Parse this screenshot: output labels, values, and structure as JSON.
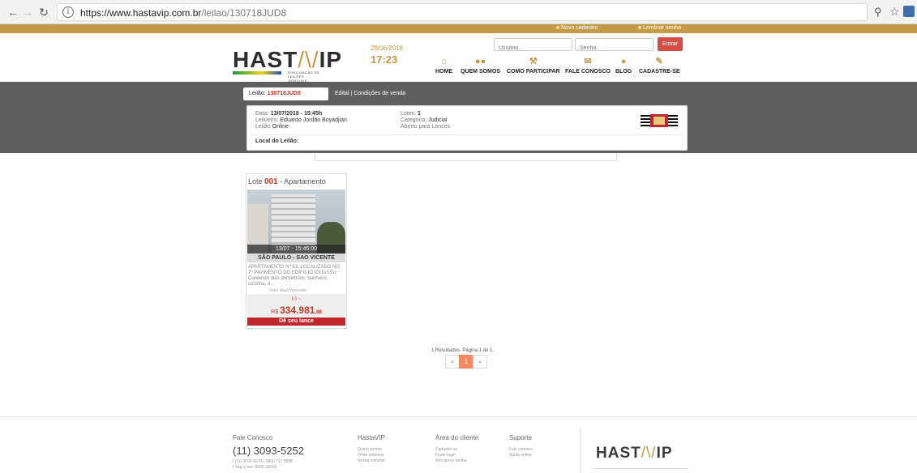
{
  "browser": {
    "url_domain": "https://www.hastavip.com.br",
    "url_path": "/leilao/130718JUD8",
    "info": "i"
  },
  "topbar": {
    "novo_cadastro": "Novo cadastro",
    "lembrar_senha": "Lembrar senha"
  },
  "header": {
    "logo_main": "HAST",
    "logo_accent": "/\\/",
    "logo_end": "IP",
    "logo_sub": "DIVULGAÇÃO DE LEILÕES JUDICIAIS",
    "date": "28/06/2018",
    "time": "17:23",
    "user_placeholder": "Usuário..",
    "pass_placeholder": "Senha..",
    "entrar": "Entrar",
    "menu": [
      {
        "label": "HOME",
        "icon": "home-icon"
      },
      {
        "label": "QUEM SOMOS",
        "icon": "people-icon"
      },
      {
        "label": "COMO PARTICIPAR",
        "icon": "gavel-icon"
      },
      {
        "label": "FALE CONOSCO",
        "icon": "mail-icon"
      },
      {
        "label": "BLOG",
        "icon": "chat-icon"
      },
      {
        "label": "CADASTRE-SE",
        "icon": "edit-icon"
      }
    ]
  },
  "auction": {
    "tab_prefix": "Leilão: ",
    "tab_code": "130718JUD8",
    "tab_other": "Edital | Condições de venda",
    "data_label": "Data: ",
    "data_value": "13/07/2018 - 15:45h",
    "leiloeiro_label": "Leiloeiro: ",
    "leiloeiro_value": "Eduardo Jordão Boyadjian",
    "leilao_label": "Leilão ",
    "leilao_value": "Online",
    "lotes_label": "Lotes: ",
    "lotes_value": "1",
    "categoria_label": "Categoria: ",
    "categoria_value": "Judicial",
    "status": "Aberto para Lances",
    "local_label": "Local do Leilão:"
  },
  "lot": {
    "lote_prefix": "Lote ",
    "number": "001",
    "type": " - Apartamento",
    "photo_datetime": "13/07 - 15:45:00",
    "city": "SÃO PAULO - SAO VICENTE",
    "description": "APARTAMENTO Nº 63, LOCALIZADO NO 7º PAVIMENTO DO EDIFICIO IGUASSU Contendo dois dormitórios, banheiro, cozinha, d..",
    "valor_label": "Valor atual/Vencedor",
    "minus": "(-) -.",
    "currency": "R$ ",
    "price_main": "334.981",
    "price_cents": ",88",
    "bid_label": "Dê seu lance"
  },
  "pagination": {
    "results": "1 Resultados. Página 1 de 1.",
    "prev": "«",
    "current": "1",
    "next": "»"
  },
  "footer": {
    "col1_head": "Fale Conosco",
    "phone": "(11) 3093-5252",
    "phone_extra": "| (11) 3032-9274 | 0800 717 8888",
    "hours": "| Seg a sex: 8h00-18h00",
    "col2_head": "HastaVIP",
    "col2_links": [
      "Quem somos",
      "Onde estamos",
      "Nossa extranet"
    ],
    "col3_head": "Área do cliente",
    "col3_links": [
      "Cadastre-se",
      "Fazer login",
      "Recuperar senha"
    ],
    "col4_head": "Suporte",
    "col4_links": [
      "Fale conosco",
      "Ajuda online"
    ],
    "logo_main": "HAST",
    "logo_accent": "/\\/",
    "logo_end": "IP"
  },
  "colors": {
    "gold": "#c29a48",
    "band": "#5f5f5f",
    "accent_red": "#c0392b"
  }
}
